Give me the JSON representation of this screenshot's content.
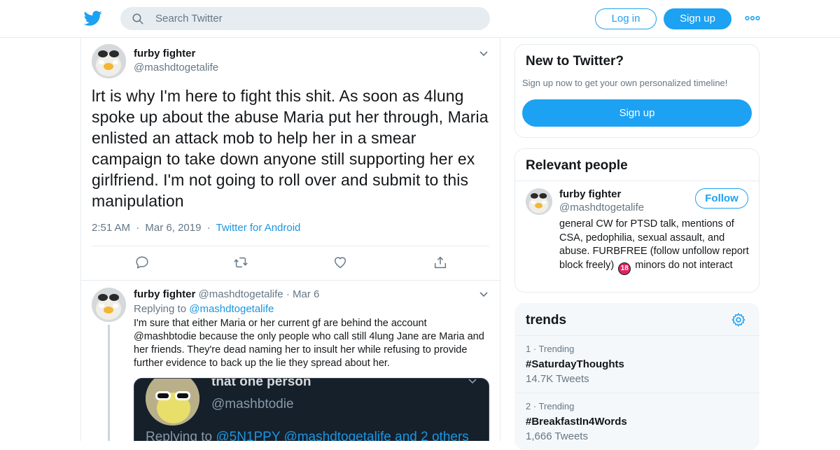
{
  "header": {
    "search_placeholder": "Search Twitter",
    "login_label": "Log in",
    "signup_label": "Sign up"
  },
  "main_tweet": {
    "name": "furby fighter",
    "handle": "@mashdtogetalife",
    "text": "lrt is why I'm here to fight this shit. As soon as 4lung spoke up about the abuse Maria put her through, Maria enlisted an attack mob to help her in a smear campaign to take down anyone still supporting her ex girlfriend. I'm not going to roll over and submit to this manipulation",
    "time": "2:51 AM",
    "date": "Mar 6, 2019",
    "source": "Twitter for Android",
    "dot": "·"
  },
  "reply_tweet": {
    "name": "furby fighter",
    "handle": "@mashdtogetalife",
    "date": "Mar 6",
    "dot": "·",
    "replying_label": "Replying to",
    "replying_to": "@mashdtogetalife",
    "text": "I'm sure that either Maria or her current gf are behind the account @mashbtodie because the only people who call still 4lung Jane are Maria and her friends. They're dead naming her to insult her while refusing to provide further evidence to back up the lie they spread about her.",
    "embed": {
      "name": "that one person",
      "handle": "@mashbtodie",
      "replying_label": "Replying to",
      "replying_to": "@5N1PPY @mashdtogetalife and 2 others"
    }
  },
  "sidebar": {
    "new_to_twitter": {
      "title": "New to Twitter?",
      "subtitle": "Sign up now to get your own personalized timeline!",
      "button": "Sign up"
    },
    "relevant_people": {
      "title": "Relevant people",
      "name": "furby fighter",
      "handle": "@mashdtogetalife",
      "follow_label": "Follow",
      "bio_before": "general CW for PTSD talk, mentions of CSA, pedophilia, sexual assault, and abuse. FURBFREE (follow unfollow report block freely)",
      "badge": "18",
      "bio_after": "minors do not interact"
    },
    "trends": {
      "title": "trends",
      "items": [
        {
          "rank": "1 · Trending",
          "tag": "#SaturdayThoughts",
          "count": "14.7K Tweets"
        },
        {
          "rank": "2 · Trending",
          "tag": "#BreakfastIn4Words",
          "count": "1,666 Tweets"
        }
      ]
    }
  },
  "colors": {
    "accent": "#1da1f2",
    "link": "#1b95e0",
    "secondary_text": "#657786",
    "border": "#e6ecf0"
  }
}
